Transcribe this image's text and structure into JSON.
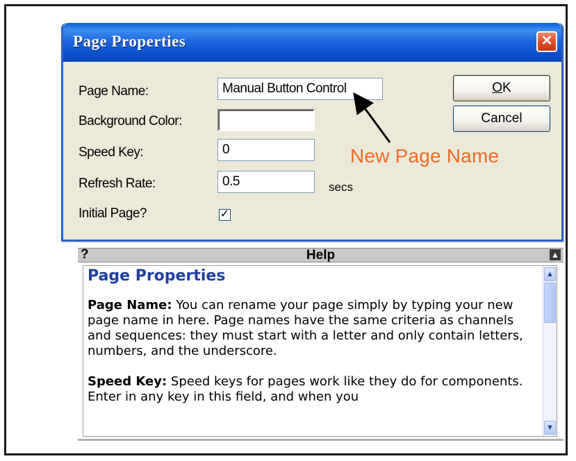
{
  "window": {
    "title": "Page Properties",
    "close_glyph": "✕"
  },
  "form": {
    "page_name_label": "Page Name:",
    "page_name_value": "Manual Button Control",
    "background_color_label": "Background Color:",
    "background_color_value": "",
    "speed_key_label": "Speed Key:",
    "speed_key_value": "0",
    "refresh_rate_label": "Refresh Rate:",
    "refresh_rate_value": "0.5",
    "refresh_rate_unit": "secs",
    "initial_page_label": "Initial Page?",
    "initial_page_checked": true,
    "initial_page_glyph": "✓"
  },
  "buttons": {
    "ok_label": "OK",
    "ok_mnemonic": "O",
    "ok_rest": "K",
    "cancel_label": "Cancel"
  },
  "annotation": {
    "text": "New Page Name",
    "color": "#f06a28"
  },
  "help": {
    "question_glyph": "?",
    "title": "Help",
    "dock_glyph": "▲",
    "heading": "Page Properties",
    "sections": [
      {
        "term": "Page Name:",
        "text": " You can rename your page simply by typing your new page name in here.  Page names have the same criteria as channels and sequences: they must start with a letter and only contain letters, numbers, and the underscore."
      },
      {
        "term": "Speed Key:",
        "text": " Speed keys for pages work like they do for components.  Enter in any key in this field, and when you"
      }
    ],
    "scroll_up_glyph": "▲",
    "scroll_down_glyph": "▼"
  },
  "colors": {
    "title_bar": "#1f69df",
    "dialog_bg": "#ece9d8",
    "close_button": "#e0502a",
    "help_heading": "#1f3fa0"
  },
  "icons": [
    "close-icon",
    "help-question-icon",
    "dock-icon",
    "checkmark-icon",
    "scroll-up-icon",
    "scroll-down-icon"
  ]
}
